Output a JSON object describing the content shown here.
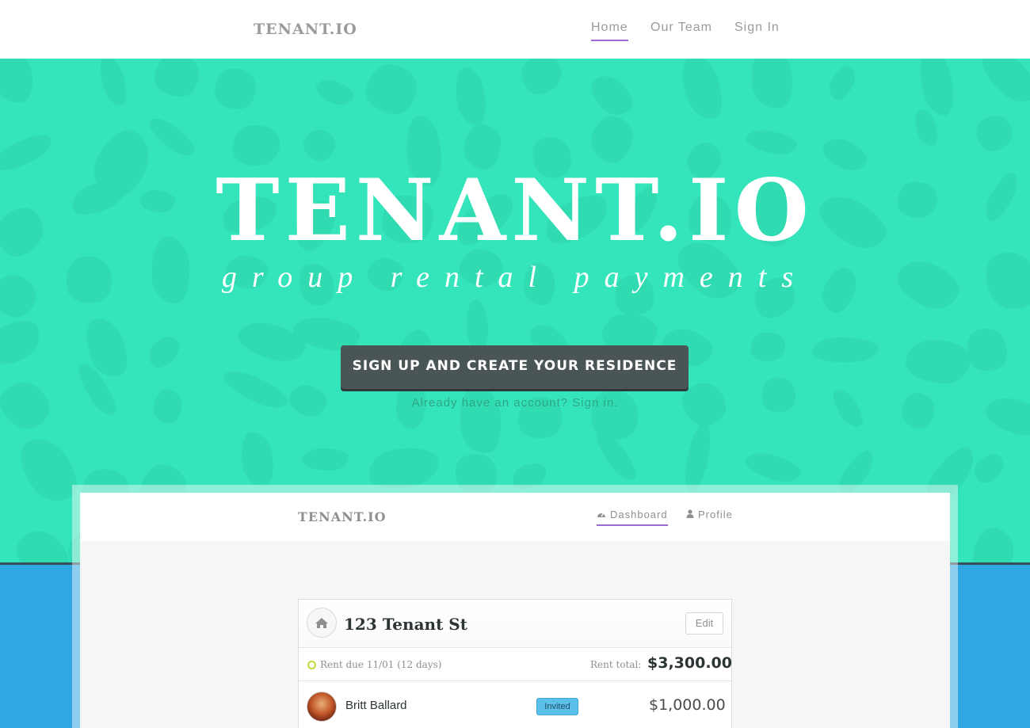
{
  "navbar": {
    "brand": "TENANT.IO",
    "items": [
      {
        "label": "Home",
        "active": true
      },
      {
        "label": "Our Team",
        "active": false
      },
      {
        "label": "Sign In",
        "active": false
      }
    ]
  },
  "hero": {
    "title": "TENANT.IO",
    "tagline": "group rental payments",
    "cta_label": "SIGN UP AND CREATE YOUR RESIDENCE",
    "signin_hint": "Already have an account? Sign in."
  },
  "preview": {
    "brand": "TENANT.IO",
    "tabs": [
      {
        "label": "Dashboard",
        "icon": "dashboard-icon",
        "active": true
      },
      {
        "label": "Profile",
        "icon": "user-icon",
        "active": false
      }
    ],
    "card": {
      "title": "123 Tenant St",
      "edit_label": "Edit",
      "rent_due": "Rent due 11/01 (12 days)",
      "rent_total_label": "Rent total:",
      "rent_total_value": "$3,300.00",
      "members": [
        {
          "name": "Britt Ballard",
          "status": "Invited",
          "amount": "$1,000.00"
        }
      ]
    }
  },
  "colors": {
    "hero_bg": "#34e4bb",
    "blue_band": "#30a7e3",
    "cta_bg": "#4a5556",
    "accent_underline": "#9b6bd8",
    "badge_bg": "#5bc0ea"
  }
}
